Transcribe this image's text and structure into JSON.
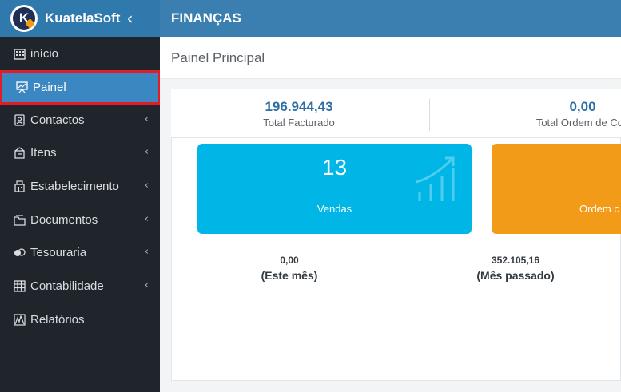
{
  "brand": {
    "name": "KuatelaSoft",
    "logo_letter": "K"
  },
  "header": {
    "section": "FINANÇAS"
  },
  "sidebar": {
    "items": [
      {
        "label": "início",
        "icon": "building-icon",
        "has_children": false
      },
      {
        "label": "Painel",
        "icon": "presentation-icon",
        "has_children": false,
        "active": true
      },
      {
        "label": "Contactos",
        "icon": "contacts-icon",
        "has_children": true
      },
      {
        "label": "Itens",
        "icon": "box-icon",
        "has_children": true
      },
      {
        "label": "Estabelecimento",
        "icon": "store-icon",
        "has_children": true
      },
      {
        "label": "Documentos",
        "icon": "documents-icon",
        "has_children": true
      },
      {
        "label": "Tesouraria",
        "icon": "coins-icon",
        "has_children": true
      },
      {
        "label": "Contabilidade",
        "icon": "ledger-icon",
        "has_children": true
      },
      {
        "label": "Relatórios",
        "icon": "reports-icon",
        "has_children": false
      }
    ]
  },
  "main": {
    "title": "Painel Principal",
    "stats": [
      {
        "value": "196.944,43",
        "label": "Total Facturado"
      },
      {
        "value": "0,00",
        "label": "Total Ordem de Con"
      }
    ],
    "cards": [
      {
        "number": "13",
        "caption": "Vendas",
        "color": "#00b6e6"
      },
      {
        "number": "",
        "caption": "Ordem c",
        "color": "#f29b19"
      }
    ],
    "periods": [
      {
        "value": "0,00",
        "label": "(Este mês)"
      },
      {
        "value": "352.105,16",
        "label": "(Mês passado)"
      }
    ]
  },
  "colors": {
    "topbar": "#3a7fb0",
    "sidebar": "#20252b",
    "active_item": "#3b87c2",
    "highlight_outline": "#e11d2a",
    "stat_value": "#2f6ea5"
  }
}
